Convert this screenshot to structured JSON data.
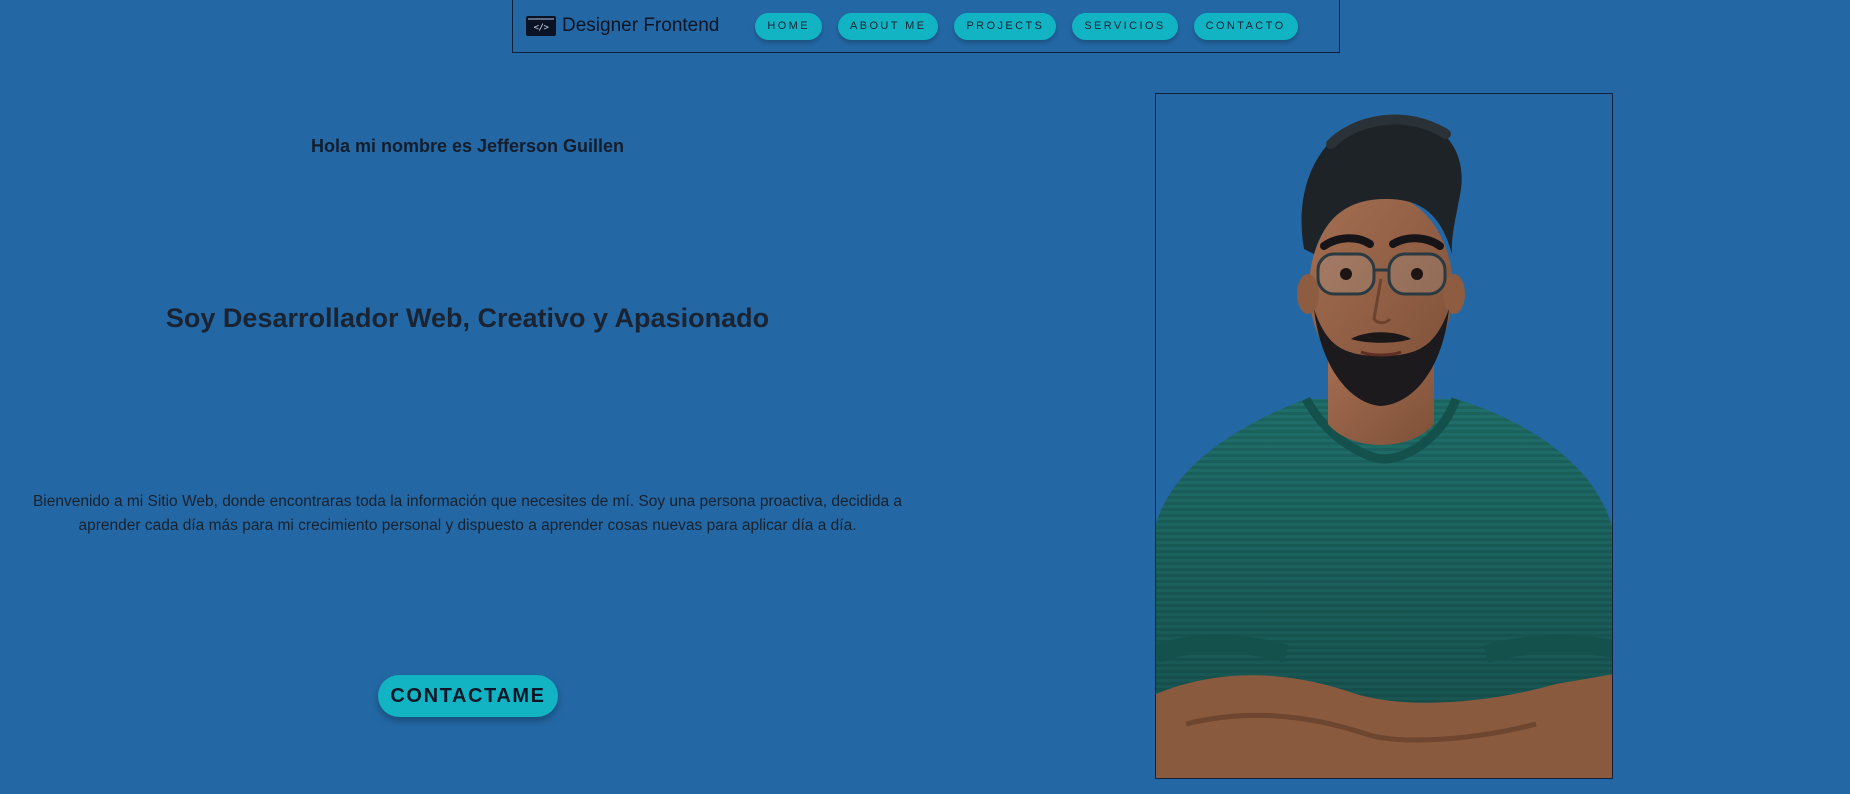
{
  "nav": {
    "brand_name": "Designer Frontend",
    "brand_icon": "code-tag-icon",
    "brand_icon_text": "</>",
    "links": [
      "HOME",
      "ABOUT ME",
      "PROJECTS",
      "SERVICIOS",
      "CONTACTO"
    ]
  },
  "hero": {
    "greeting": "Hola mi nombre es Jefferson Guillen",
    "role": "Soy Desarrollador Web, Creativo y Apasionado",
    "intro_line1": "Bienvenido a mi Sitio Web, donde encontraras toda la información que necesites de mí. Soy una persona proactiva, decidida a",
    "intro_line2": "aprender cada día más para mi crecimiento personal y dispuesto a aprender cosas nuevas para aplicar día a día.",
    "cta_label": "CONTACTAME"
  },
  "colors": {
    "background": "#2368a5",
    "accent": "#12b4c4",
    "text": "#1c2430"
  }
}
